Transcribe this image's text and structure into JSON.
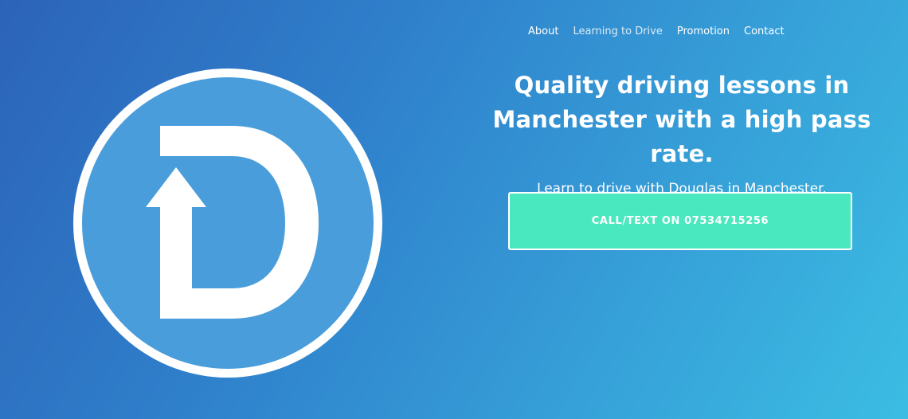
{
  "logo": {
    "icon": "d-arrow-logo-icon",
    "colors": {
      "ring": "#ffffff",
      "fill": "#4a9ddb",
      "mark": "#ffffff"
    }
  },
  "nav": {
    "items": [
      {
        "label": "About"
      },
      {
        "label": "Learning to Drive"
      },
      {
        "label": "Promotion"
      },
      {
        "label": "Contact"
      }
    ]
  },
  "hero": {
    "title": "Quality driving lessons in Manchester with a high pass rate.",
    "subtitle": "Learn to drive with Douglas in Manchester."
  },
  "cta": {
    "label": "CALL/TEXT ON 07534715256",
    "color": "#4ae8be"
  }
}
